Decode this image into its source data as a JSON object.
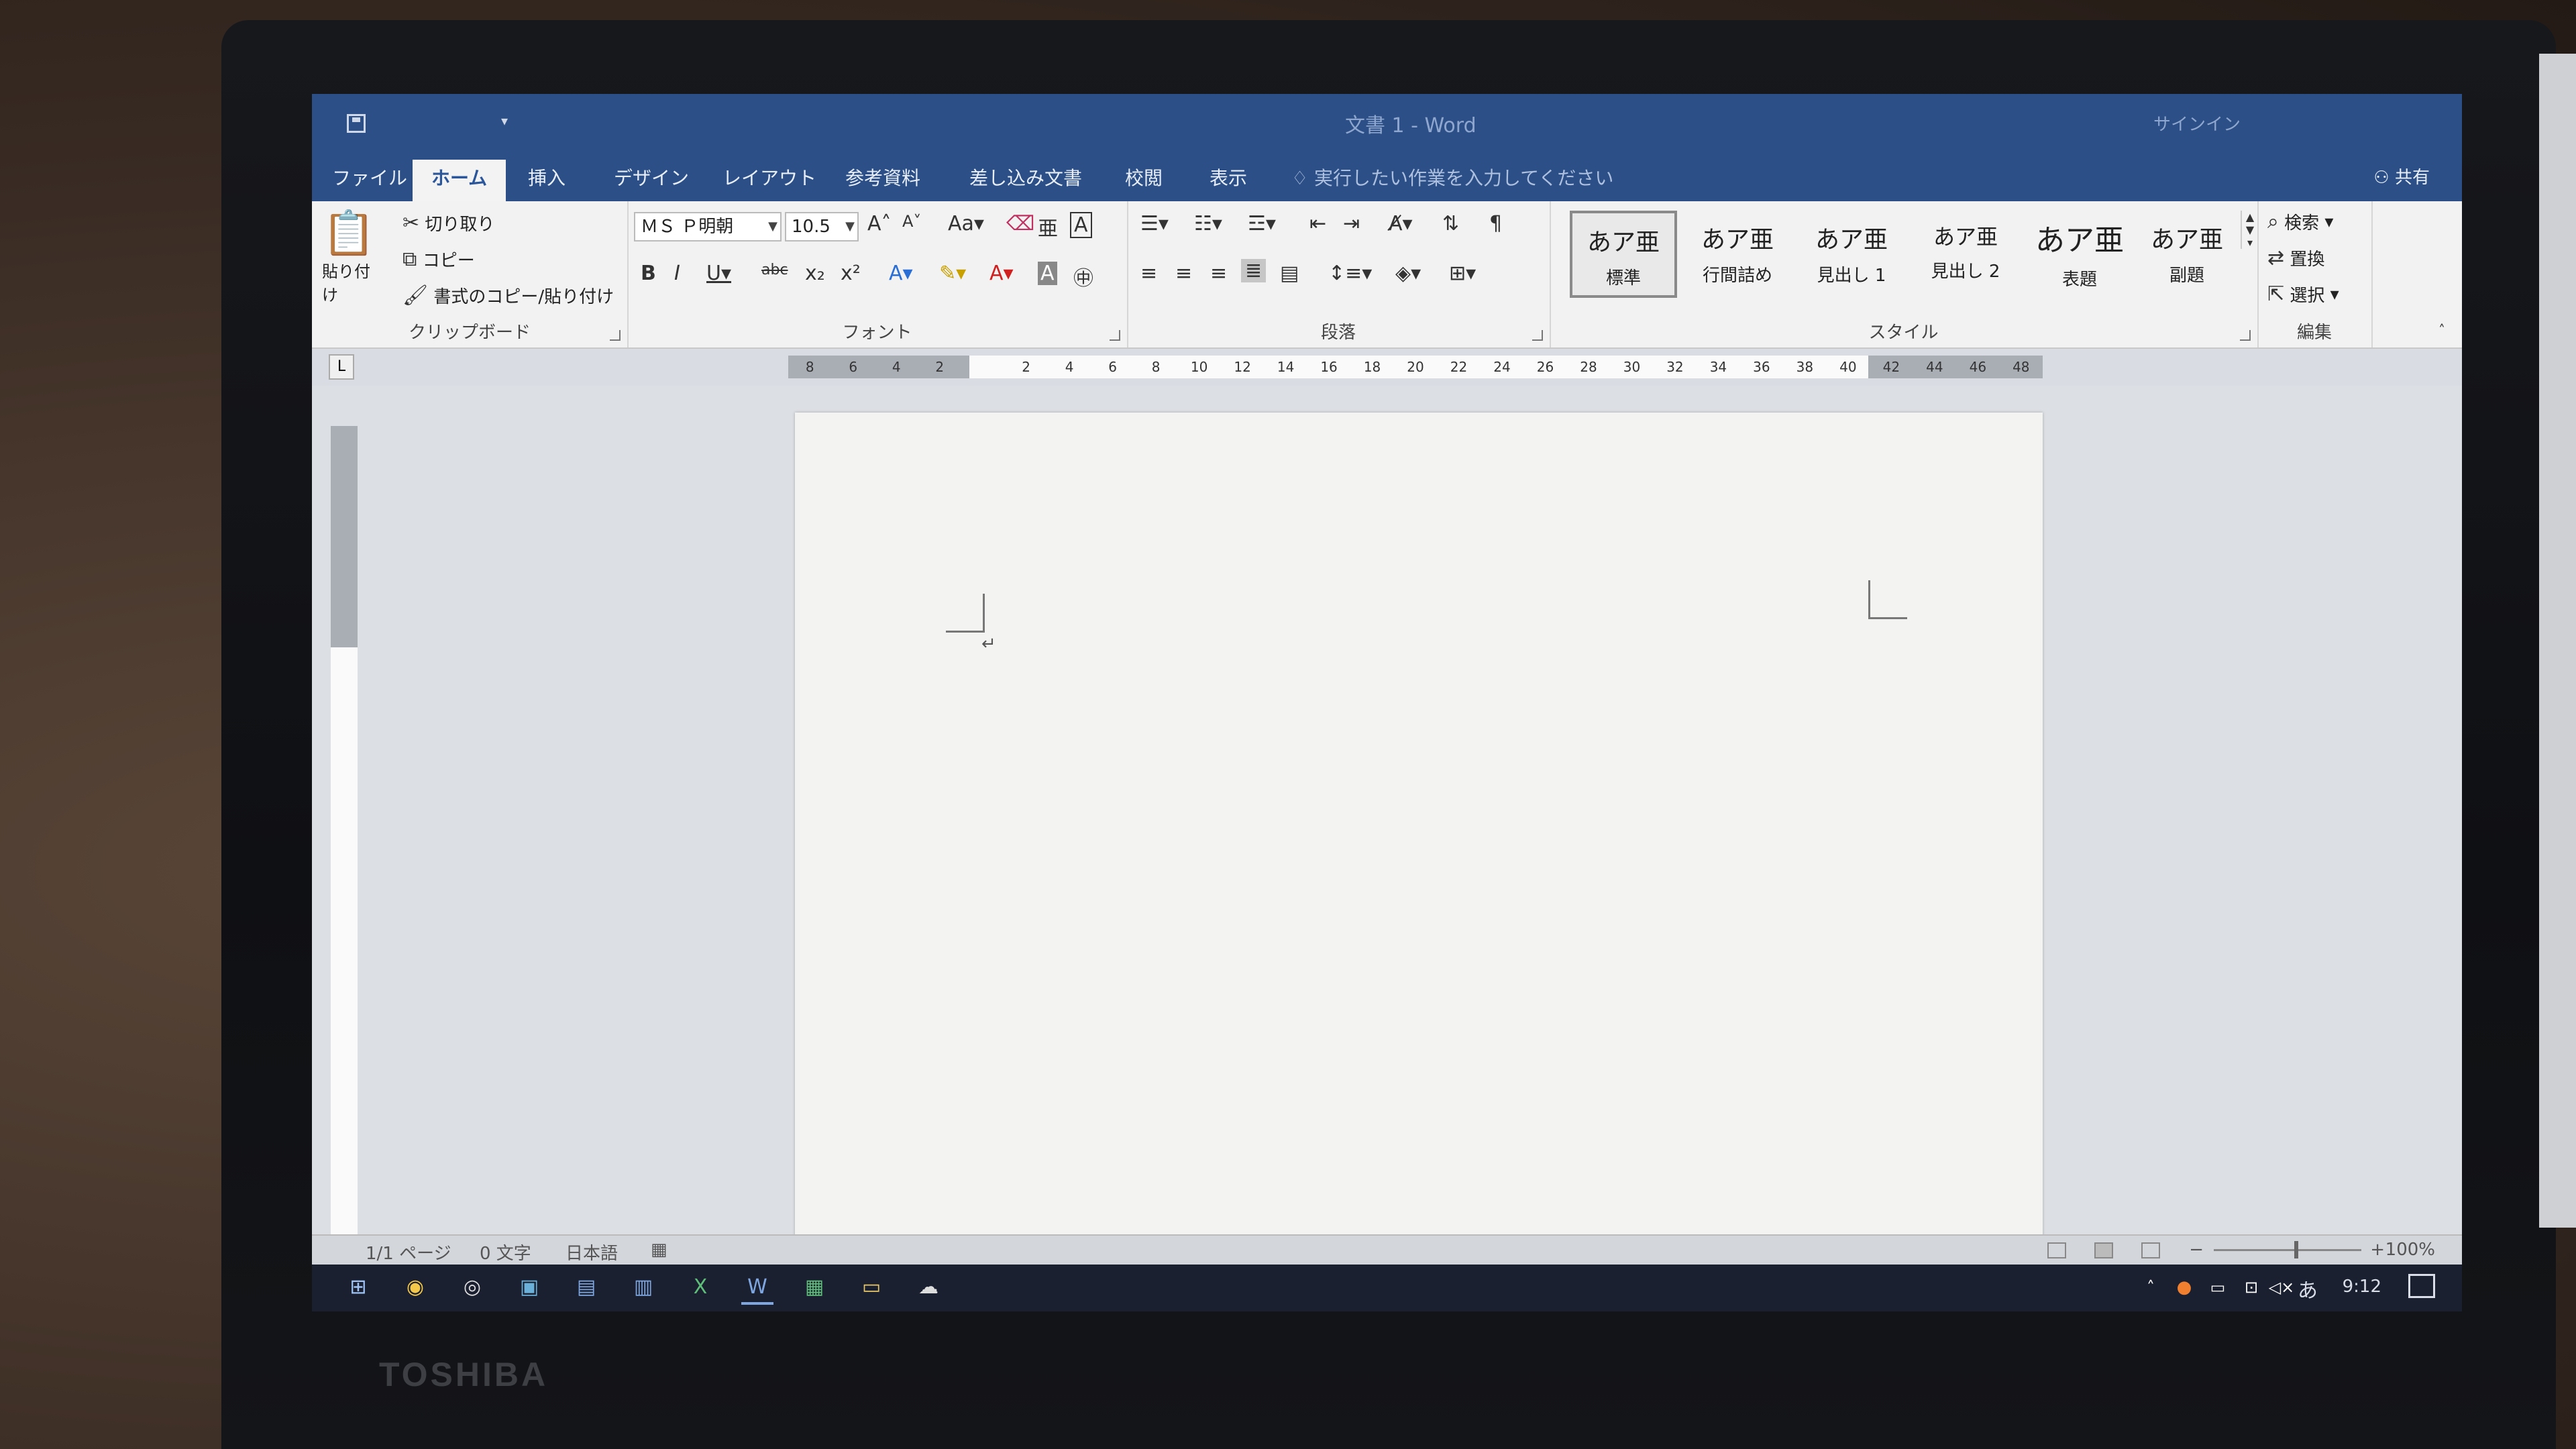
{
  "window": {
    "title": "文書 1 - Word",
    "signin": "サインイン"
  },
  "qat": {
    "customize": "▾"
  },
  "tabs": [
    "ファイル",
    "ホーム",
    "挿入",
    "デザイン",
    "レイアウト",
    "参考資料",
    "差し込み文書",
    "校閲",
    "表示"
  ],
  "tell_me": "実行したい作業を入力してください",
  "share": "共有",
  "clipboard": {
    "label": "クリップボード",
    "paste": "貼り付け",
    "cut": "切り取り",
    "copy": "コピー",
    "format_painter": "書式のコピー/貼り付け"
  },
  "font": {
    "label": "フォント",
    "name": "ＭＳ Ｐ明朝",
    "size": "10.5"
  },
  "paragraph": {
    "label": "段落"
  },
  "styles": {
    "label": "スタイル",
    "items": [
      {
        "sample": "あア亜",
        "name": "標準"
      },
      {
        "sample": "あア亜",
        "name": "行間詰め"
      },
      {
        "sample": "あア亜",
        "name": "見出し 1"
      },
      {
        "sample": "あア亜",
        "name": "見出し 2"
      },
      {
        "sample": "あア亜",
        "name": "表題"
      },
      {
        "sample": "あア亜",
        "name": "副題"
      }
    ]
  },
  "editing": {
    "label": "編集",
    "find": "検索",
    "replace": "置換",
    "select": "選択"
  },
  "ruler": {
    "tab_selector": "L",
    "labels": [
      "8",
      "6",
      "4",
      "2",
      "",
      "2",
      "4",
      "6",
      "8",
      "10",
      "12",
      "14",
      "16",
      "18",
      "20",
      "22",
      "24",
      "26",
      "28",
      "30",
      "32",
      "34",
      "36",
      "38",
      "40",
      "42",
      "44",
      "46",
      "48"
    ]
  },
  "document": {
    "paragraph_mark": "↵"
  },
  "status": {
    "page": "1/1 ページ",
    "words": "0 文字",
    "language": "日本語",
    "zoom": "100%"
  },
  "taskbar": {
    "clock": "9:12",
    "ime": "あ"
  },
  "brand": "TOSHIBA",
  "icons": {
    "save": "save-icon",
    "paste": "paste-icon",
    "cut": "scissors-icon",
    "copy": "copy-icon",
    "format_painter": "paintbrush-icon",
    "find": "search-icon",
    "replace": "replace-icon",
    "select": "cursor-icon"
  },
  "colors": {
    "title_bar": "#2b4f86",
    "ribbon": "#f2f2f2",
    "page": "#f3f4f2",
    "taskbar": "#1a2030"
  }
}
